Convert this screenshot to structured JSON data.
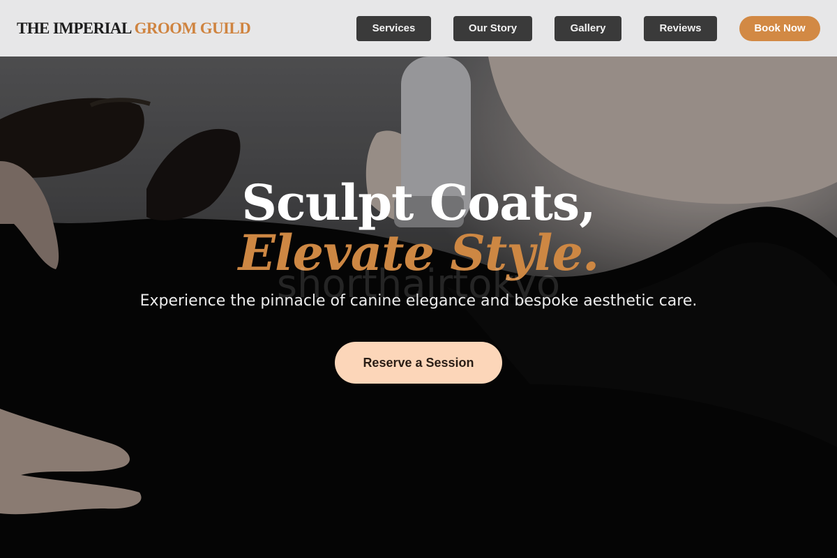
{
  "brand": {
    "name_part1": "THE IMPERIAL",
    "name_part2": "GROOM GUILD"
  },
  "nav": {
    "items": [
      {
        "label": "Services"
      },
      {
        "label": "Our Story"
      },
      {
        "label": "Gallery"
      },
      {
        "label": "Reviews"
      }
    ],
    "book_label": "Book Now"
  },
  "hero": {
    "headline_line1": "Sculpt Coats,",
    "headline_line2": "Elevate Style.",
    "watermark": "shorthairtokyo",
    "subtitle": "Experience the pinnacle of canine elegance and bespoke aesthetic care.",
    "cta_label": "Reserve a Session"
  },
  "colors": {
    "accent": "#cf8440",
    "nav_button": "#3a3a3a",
    "header_bg": "#e7e7e8",
    "cta_bg": "#fcd6b9"
  }
}
